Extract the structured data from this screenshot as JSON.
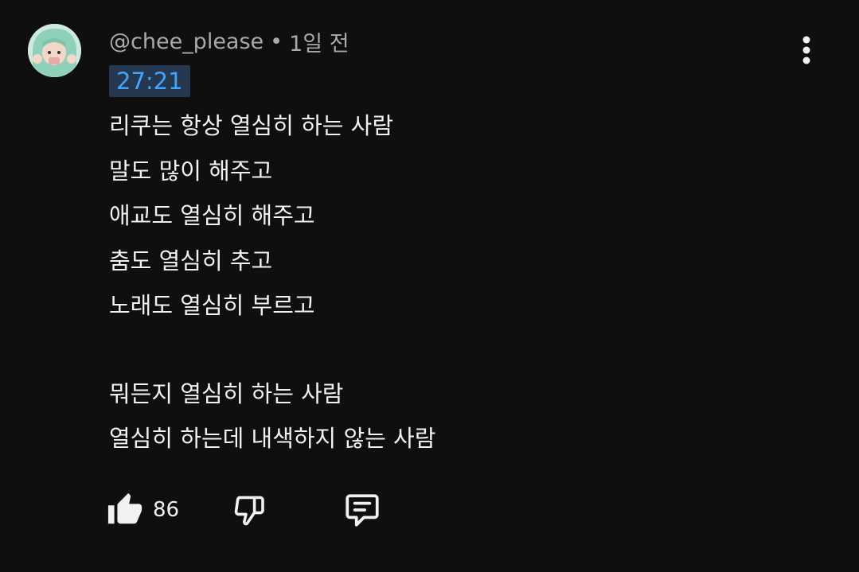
{
  "comment": {
    "author": "@chee_please",
    "separator": "•",
    "time_ago": "1일 전",
    "timestamp_link": "27:21",
    "lines": [
      "리쿠는 항상 열심히 하는 사람",
      "말도 많이 해주고",
      "애교도 열심히 해주고",
      "춤도 열심히 추고",
      "노래도 열심히 부르고",
      "",
      "뭐든지 열심히 하는 사람",
      "열심히 하는데 내색하지 않는 사람"
    ]
  },
  "actions": {
    "like_count": "86",
    "icons": {
      "like": "thumbs-up-icon",
      "dislike": "thumbs-down-icon",
      "reply": "comment-icon",
      "more": "more-vert-icon"
    }
  },
  "colors": {
    "background": "#0f0f0f",
    "text": "#f1f1f1",
    "secondary_text": "#aaaaaa",
    "timestamp_link": "#3ea6ff",
    "timestamp_bg": "#263850"
  }
}
